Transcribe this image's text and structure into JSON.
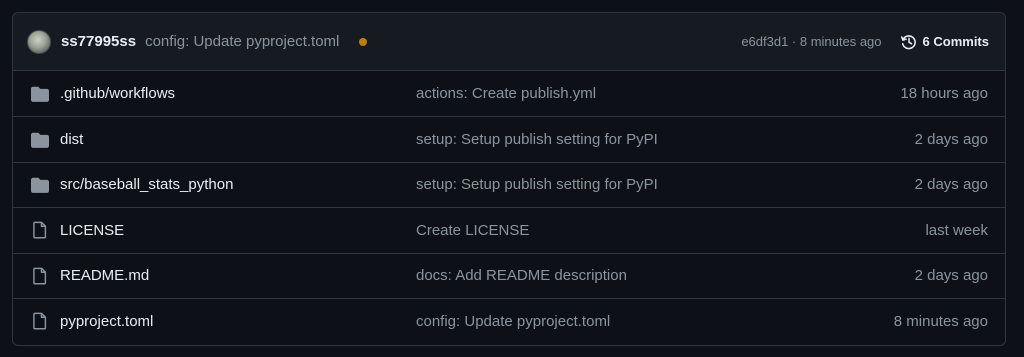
{
  "header": {
    "author": "ss77995ss",
    "message": "config: Update pyproject.toml",
    "status_color": "#bb8009",
    "sha_time": "e6df3d1 · 8 minutes ago",
    "commits_label": "6 Commits",
    "commits_icon": "history-icon"
  },
  "files": [
    {
      "name": ".github/workflows",
      "type": "folder",
      "icon": "folder-icon",
      "message": "actions: Create publish.yml",
      "time": "18 hours ago"
    },
    {
      "name": "dist",
      "type": "folder",
      "icon": "folder-icon",
      "message": "setup: Setup publish setting for PyPI",
      "time": "2 days ago"
    },
    {
      "name": "src/baseball_stats_python",
      "type": "folder",
      "icon": "folder-icon",
      "message": "setup: Setup publish setting for PyPI",
      "time": "2 days ago"
    },
    {
      "name": "LICENSE",
      "type": "file",
      "icon": "file-icon",
      "message": "Create LICENSE",
      "time": "last week"
    },
    {
      "name": "README.md",
      "type": "file",
      "icon": "file-icon",
      "message": "docs: Add README description",
      "time": "2 days ago"
    },
    {
      "name": "pyproject.toml",
      "type": "file",
      "icon": "file-icon",
      "message": "config: Update pyproject.toml",
      "time": "8 minutes ago"
    }
  ]
}
